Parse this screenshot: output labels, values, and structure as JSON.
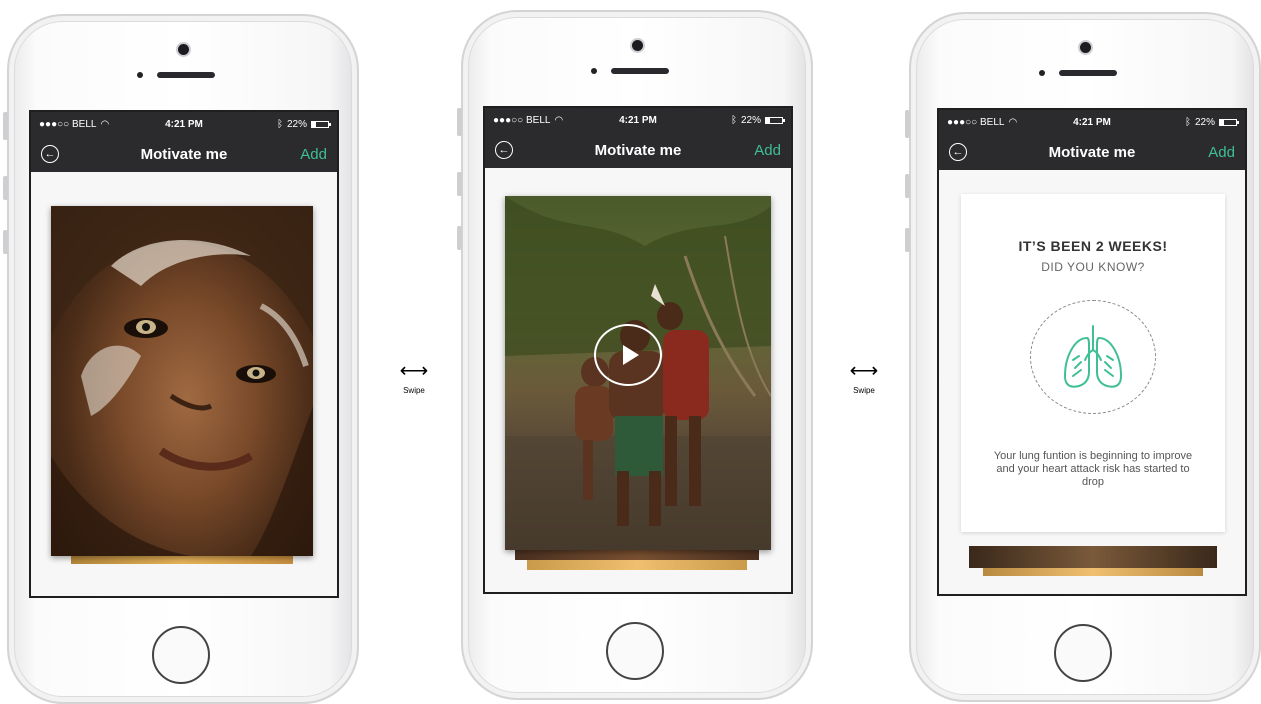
{
  "colors": {
    "accent": "#3fbf94",
    "navbar": "#2b2b2d",
    "screen_bg": "#f7f7f7"
  },
  "phones": [
    {
      "status": {
        "carrier": "●●●○○ BELL",
        "time": "4:21 PM",
        "battery": "22%"
      },
      "nav": {
        "back_icon": "back-arrow-icon",
        "title": "Motivate me",
        "action": "Add"
      },
      "content": "photo-card"
    },
    {
      "status": {
        "carrier": "●●●○○ BELL",
        "time": "4:21 PM",
        "battery": "22%"
      },
      "nav": {
        "back_icon": "back-arrow-icon",
        "title": "Motivate me",
        "action": "Add"
      },
      "content": "video-card"
    },
    {
      "status": {
        "carrier": "●●●○○ BELL",
        "time": "4:21 PM",
        "battery": "22%"
      },
      "nav": {
        "back_icon": "back-arrow-icon",
        "title": "Motivate me",
        "action": "Add"
      },
      "content": "info-card"
    }
  ],
  "info_card": {
    "heading": "IT’S BEEN 2 WEEKS!",
    "subheading": "DID YOU KNOW?",
    "icon": "lungs-icon",
    "body": "Your lung funtion is beginning to improve and your heart attack risk has started to drop"
  },
  "swipe_labels": [
    "Swipe",
    "Swipe"
  ]
}
